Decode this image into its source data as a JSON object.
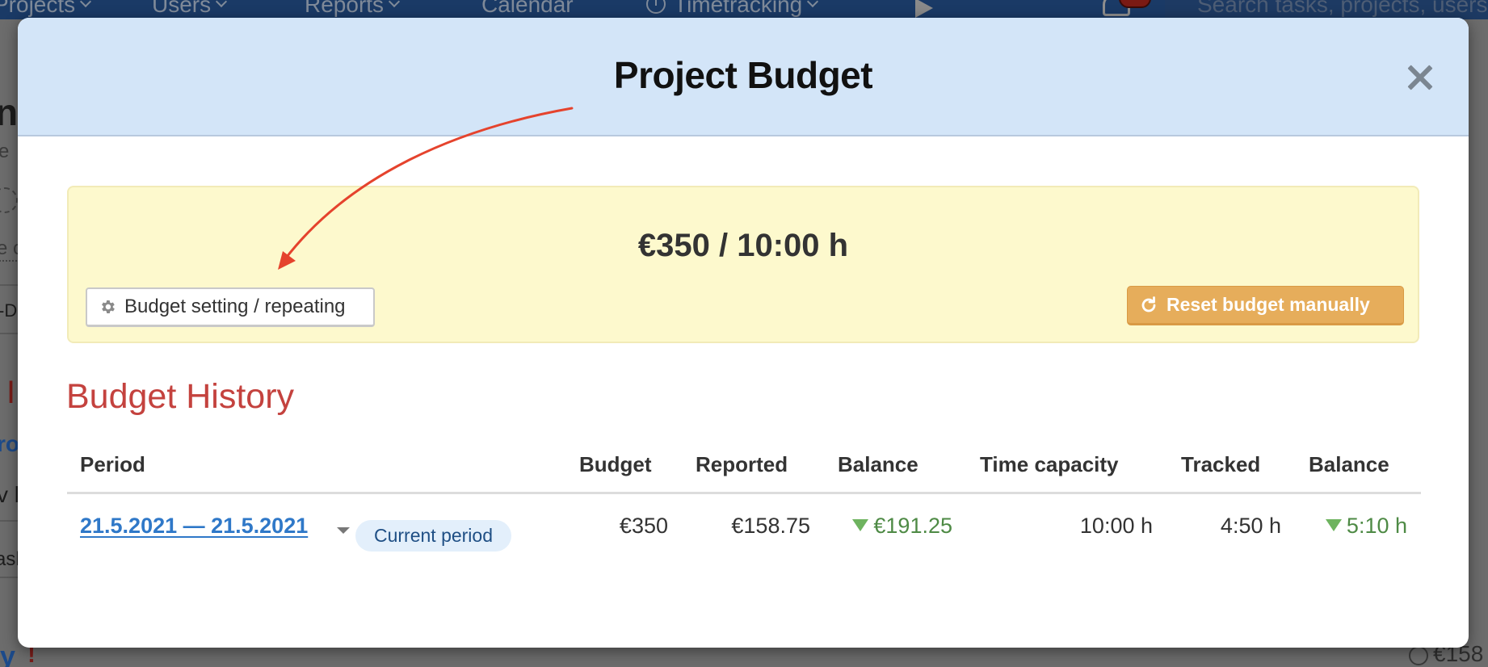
{
  "background": {
    "nav": {
      "items": [
        {
          "label": "Projects",
          "has_dropdown": true
        },
        {
          "label": "Users",
          "has_dropdown": true
        },
        {
          "label": "Reports",
          "has_dropdown": true
        },
        {
          "label": "Calendar",
          "has_dropdown": false
        },
        {
          "label": "Timetracking",
          "has_dropdown": true
        }
      ],
      "search_placeholder": "Search tasks, projects, users"
    },
    "fragments": {
      "heading_char": "n",
      "sub1": "e",
      "sub2": "e c",
      "tab": "-D",
      "red_char": "I",
      "blue_text": "ro",
      "text1": "v k",
      "text2": "asl",
      "bottom_left": "y",
      "bottom_exclaim": "!",
      "bottom_right": "€158"
    }
  },
  "modal": {
    "title": "Project Budget",
    "close_icon": "close-icon",
    "budget_summary": "€350 / 10:00 h",
    "setting_button": {
      "label": "Budget setting / repeating",
      "icon": "gear-icon"
    },
    "reset_button": {
      "label": "Reset budget manually",
      "icon": "refresh-icon"
    },
    "history_title": "Budget History",
    "table": {
      "columns": [
        "Period",
        "Budget",
        "Reported",
        "Balance",
        "Time capacity",
        "Tracked",
        "Balance"
      ],
      "rows": [
        {
          "period": "21.5.2021 — 21.5.2021",
          "badge": "Current period",
          "budget": "€350",
          "reported": "€158.75",
          "balance": "€191.25",
          "time_capacity": "10:00 h",
          "tracked": "4:50 h",
          "time_balance": "5:10 h"
        }
      ]
    }
  },
  "colors": {
    "header_bg": "#d3e5f8",
    "budget_box_bg": "#fdf9cd",
    "reset_button": "#e6ad5b",
    "history_title": "#c4423e",
    "link": "#2f78c8",
    "positive_balance": "#4e8a45",
    "annotation_arrow": "#e5432d"
  }
}
